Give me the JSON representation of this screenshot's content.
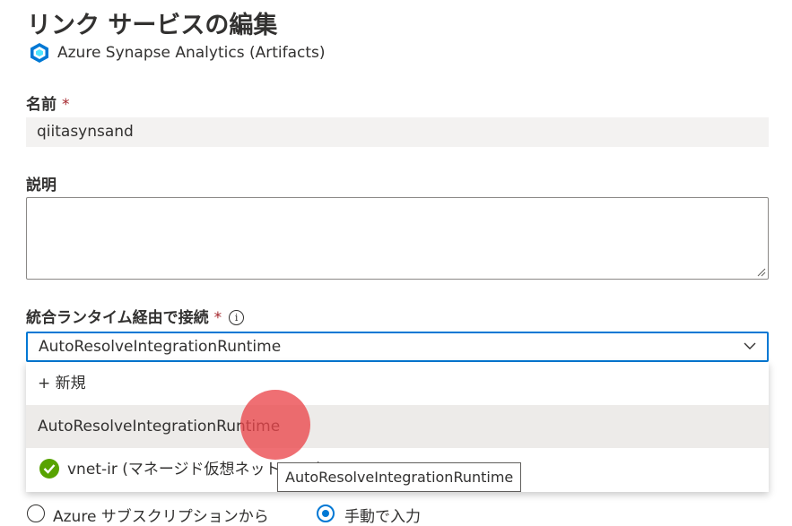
{
  "panel": {
    "title": "リンク サービスの編集",
    "subtitle": "Azure Synapse Analytics (Artifacts)"
  },
  "form": {
    "name_label": "名前",
    "required_mark": "*",
    "name_value": "qiitasynsand",
    "description_label": "説明",
    "description_value": "",
    "ir_label": "統合ランタイム経由で接続",
    "info_glyph": "i",
    "ir_selected": "AutoResolveIntegrationRuntime"
  },
  "dropdown": {
    "options": [
      {
        "label": "+ 新規"
      },
      {
        "label": "AutoResolveIntegrationRuntime"
      },
      {
        "label": "vnet-ir (マネージド仮想ネットワーク)",
        "status_icon": "check-circle-icon",
        "status_color": "#57a300"
      }
    ]
  },
  "tooltip": {
    "text": "AutoResolveIntegrationRuntime"
  },
  "account_selection": {
    "options": [
      {
        "label": "Azure サブスクリプションから",
        "selected": false
      },
      {
        "label": "手動で入力",
        "selected": true
      }
    ]
  },
  "colors": {
    "accent": "#0078d4",
    "required": "#a4262c",
    "cursor_highlight": "#eb464b"
  }
}
